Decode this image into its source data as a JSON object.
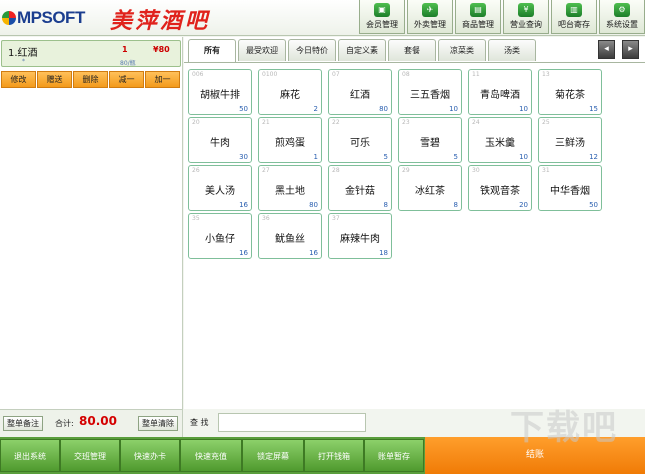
{
  "header": {
    "logo_text": "MPSOFT",
    "brand": "美萍酒吧",
    "nav": [
      {
        "label": "会员管理",
        "icon": "member-card-icon"
      },
      {
        "label": "外卖管理",
        "icon": "delivery-icon"
      },
      {
        "label": "商品管理",
        "icon": "goods-icon"
      },
      {
        "label": "营业查询",
        "icon": "yen-icon"
      },
      {
        "label": "吧台寄存",
        "icon": "storage-icon"
      },
      {
        "label": "系统设置",
        "icon": "gear-icon"
      }
    ]
  },
  "order": {
    "item": {
      "name": "1.红酒",
      "qty": "1",
      "price": "¥80",
      "sub_left": "*",
      "sub_right": "80/瓶"
    },
    "actions": [
      "修改",
      "赠送",
      "删除",
      "减一",
      "加一"
    ],
    "note_button": "整单备注",
    "total_label": "合计:",
    "total_value": "80.00",
    "clear_button": "整单清除"
  },
  "tabs": [
    "所有",
    "最受欢迎",
    "今日特价",
    "自定义素",
    "套餐",
    "凉菜类",
    "汤类"
  ],
  "active_tab": 0,
  "scroll": {
    "prev": "◂",
    "next": "▸"
  },
  "products": [
    {
      "code": "006",
      "name": "胡椒牛排",
      "stock": "50"
    },
    {
      "code": "0100",
      "name": "麻花",
      "stock": "2"
    },
    {
      "code": "07",
      "name": "红酒",
      "stock": "80"
    },
    {
      "code": "08",
      "name": "三五香烟",
      "stock": "10"
    },
    {
      "code": "11",
      "name": "青岛啤酒",
      "stock": "10"
    },
    {
      "code": "13",
      "name": "菊花茶",
      "stock": "15"
    },
    {
      "code": "20",
      "name": "牛肉",
      "stock": "30"
    },
    {
      "code": "21",
      "name": "煎鸡蛋",
      "stock": "1"
    },
    {
      "code": "22",
      "name": "可乐",
      "stock": "5"
    },
    {
      "code": "23",
      "name": "雪碧",
      "stock": "5"
    },
    {
      "code": "24",
      "name": "玉米羹",
      "stock": "10"
    },
    {
      "code": "25",
      "name": "三鲜汤",
      "stock": "12"
    },
    {
      "code": "26",
      "name": "美人汤",
      "stock": "16"
    },
    {
      "code": "27",
      "name": "黑土地",
      "stock": "80"
    },
    {
      "code": "28",
      "name": "金针菇",
      "stock": "8"
    },
    {
      "code": "29",
      "name": "冰红茶",
      "stock": "8"
    },
    {
      "code": "30",
      "name": "铁观音茶",
      "stock": "20"
    },
    {
      "code": "31",
      "name": "中华香烟",
      "stock": "50"
    },
    {
      "code": "35",
      "name": "小鱼仔",
      "stock": "16"
    },
    {
      "code": "36",
      "name": "鱿鱼丝",
      "stock": "16"
    },
    {
      "code": "37",
      "name": "麻辣牛肉",
      "stock": "18"
    }
  ],
  "search": {
    "label": "查 找",
    "value": ""
  },
  "bottom": {
    "buttons": [
      "退出系统",
      "交班管理",
      "快速办卡",
      "快速充值",
      "锁定屏幕",
      "打开钱箱",
      "账单暂存"
    ],
    "checkout": "结账"
  },
  "watermark": "下载吧"
}
